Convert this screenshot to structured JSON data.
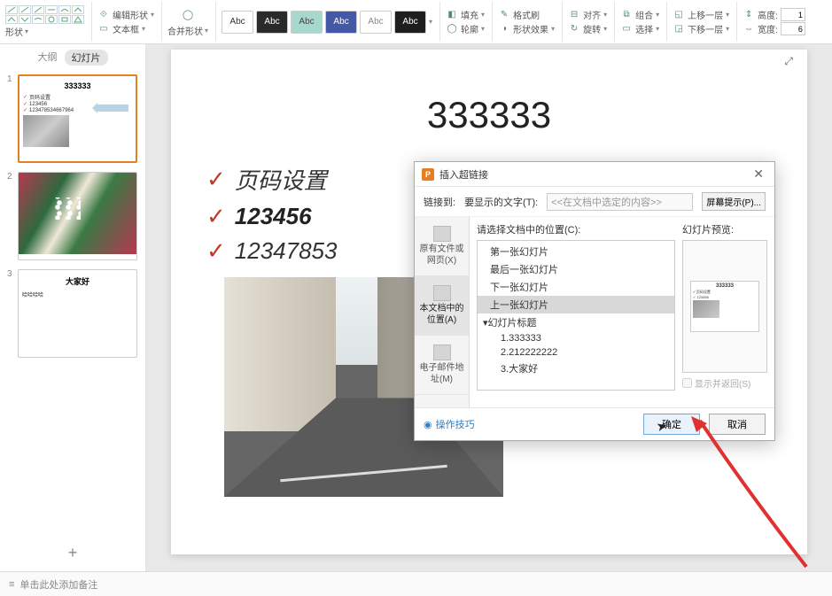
{
  "ribbon": {
    "shape_label": "形状",
    "edit_shape": "编辑形状",
    "text_box": "文本框",
    "merge_shapes": "合并形状",
    "style_label": "Abc",
    "fill": "填充",
    "outline": "轮廓",
    "format_painter": "格式刷",
    "shape_effects": "形状效果",
    "align": "对齐",
    "rotate": "旋转",
    "group": "组合",
    "select": "选择",
    "bring_forward": "上移一层",
    "send_backward": "下移一层",
    "height_label": "高度:",
    "width_label": "宽度:",
    "height_value": "1",
    "width_value": "6"
  },
  "sidepane": {
    "outline_tab": "大纲",
    "slides_tab": "幻灯片",
    "thumbs": [
      {
        "title": "333333",
        "lines": [
          "页码设置",
          "123456",
          "123478534667964"
        ]
      },
      {
        "title": "222222222"
      },
      {
        "title": "大家好",
        "lines": [
          "哈哈哈哈"
        ]
      }
    ],
    "add": "+"
  },
  "slide": {
    "title": "333333",
    "bullets": [
      "页码设置",
      "123456",
      "12347853"
    ]
  },
  "dialog": {
    "title": "插入超链接",
    "link_to": "链接到:",
    "display_text_label": "要显示的文字(T):",
    "display_text_value": "<<在文档中选定的内容>>",
    "screen_tip": "屏幕提示(P)...",
    "nav": {
      "existing": "原有文件或网页(X)",
      "this_doc": "本文档中的位置(A)",
      "email": "电子邮件地址(M)"
    },
    "select_place": "请选择文档中的位置(C):",
    "tree": {
      "first": "第一张幻灯片",
      "last": "最后一张幻灯片",
      "next": "下一张幻灯片",
      "prev": "上一张幻灯片",
      "titles_group": "幻灯片标题",
      "t1": "1.333333",
      "t2": "2.212222222",
      "t3": "3.大家好"
    },
    "preview_label": "幻灯片预览:",
    "show_return": "显示并返回(S)",
    "tips": "操作技巧",
    "ok": "确定",
    "cancel": "取消"
  },
  "notes": "单击此处添加备注"
}
